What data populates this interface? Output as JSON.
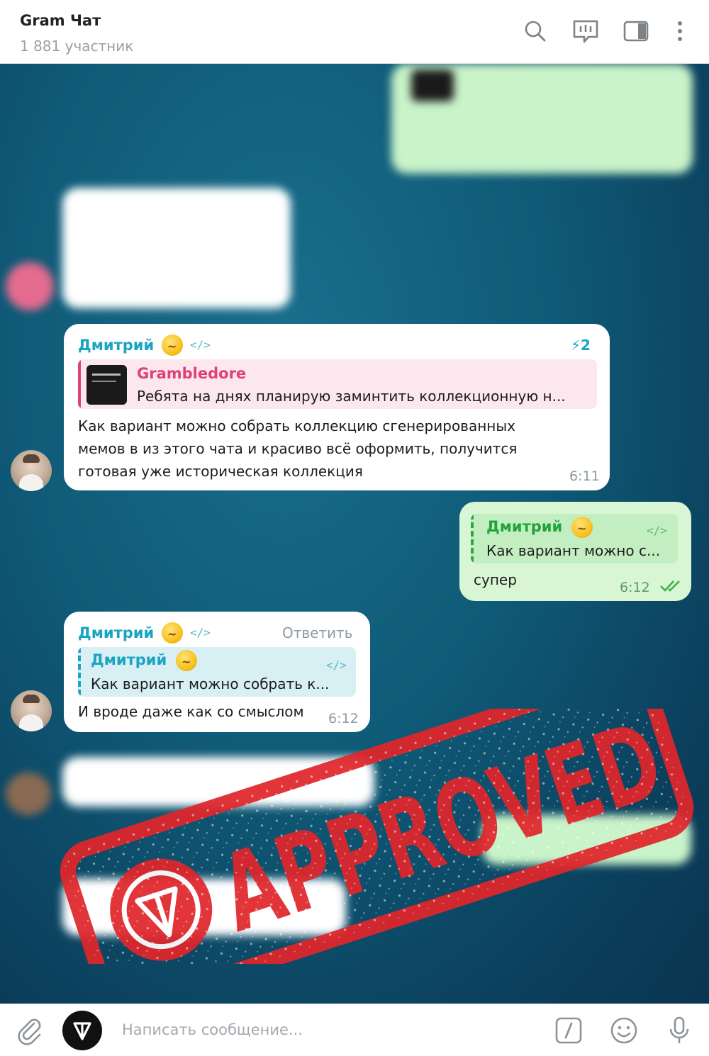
{
  "header": {
    "title": "Gram Чат",
    "subtitle": "1 881 участник",
    "icons": [
      "search-icon",
      "chat-icon",
      "sidebar-icon",
      "more-icon"
    ]
  },
  "messages": [
    {
      "author": "Дмитрий",
      "reply_count": "2",
      "quote_author": "Grambledore",
      "quote_text": "Ребята на днях планирую заминтить коллекционную н...",
      "text_lines": [
        "Как вариант можно собрать коллекцию сгенерированных",
        "мемов в из этого чата и красиво всё оформить, получится",
        "готовая уже историческая  коллекция"
      ],
      "time": "6:11"
    },
    {
      "author": "Дмитрий",
      "quote_text": "Как вариант можно с...",
      "text": "супер",
      "time": "6:12",
      "outgoing": true
    },
    {
      "author": "Дмитрий",
      "reply_label": "Ответить",
      "quote_author": "Дмитрий",
      "quote_text": "Как вариант можно собрать к...",
      "text": "И вроде даже как со смыслом",
      "time": "6:12"
    }
  ],
  "stamp": {
    "text": "APPROVED",
    "color": "#e0262b"
  },
  "composer": {
    "placeholder": "Написать сообщение...",
    "icons": [
      "paperclip-icon",
      "ton-logo-icon",
      "command-icon",
      "emoji-icon",
      "microphone-icon"
    ]
  },
  "colors": {
    "accent": "#1aa4c4",
    "out_bubble": "#d9f6d4",
    "quote_pink": "#e0407a",
    "check": "#3bb54a"
  }
}
